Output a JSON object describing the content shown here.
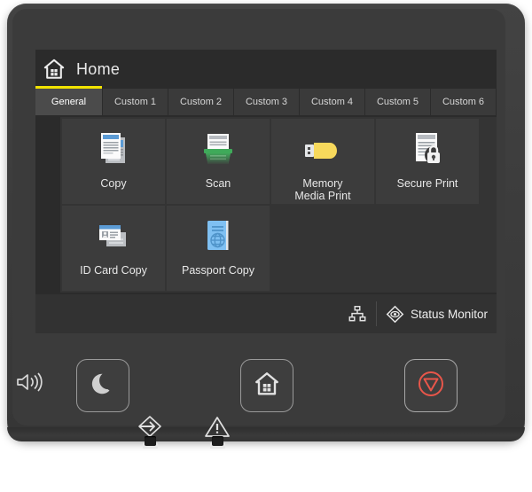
{
  "device": {
    "screen_header": {
      "home_icon": "home-house-icon",
      "title": "Home"
    },
    "tabs": [
      {
        "label": "General",
        "active": true
      },
      {
        "label": "Custom 1",
        "active": false
      },
      {
        "label": "Custom 2",
        "active": false
      },
      {
        "label": "Custom 3",
        "active": false
      },
      {
        "label": "Custom 4",
        "active": false
      },
      {
        "label": "Custom 5",
        "active": false
      },
      {
        "label": "Custom 6",
        "active": false
      }
    ],
    "functions": [
      {
        "label": "Copy",
        "icon": "copy-documents-icon"
      },
      {
        "label": "Scan",
        "icon": "scanner-icon"
      },
      {
        "label": "Memory\nMedia Print",
        "label_line1": "Memory",
        "label_line2": "Media Print",
        "icon": "usb-drive-icon"
      },
      {
        "label": "Secure Print",
        "icon": "document-lock-icon"
      },
      {
        "label": "ID Card Copy",
        "icon": "id-card-icon"
      },
      {
        "label": "Passport Copy",
        "icon": "passport-booklet-icon"
      }
    ],
    "status_bar": {
      "network_icon": "network-nodes-icon",
      "status_monitor_icon": "status-monitor-diamond-icon",
      "status_monitor_label": "Status Monitor"
    },
    "hardware_keys": [
      {
        "name": "energy-saver-key",
        "icon": "moon-icon"
      },
      {
        "name": "home-key",
        "icon": "home-house-icon"
      },
      {
        "name": "stop-key",
        "icon": "stop-circle-triangle-icon"
      }
    ],
    "indicators": [
      {
        "name": "speaker-indicator",
        "icon": "speaker-sound-icon"
      },
      {
        "name": "data-indicator",
        "icon": "data-arrow-diamond-icon"
      },
      {
        "name": "error-indicator",
        "icon": "warning-triangle-icon"
      }
    ],
    "colors": {
      "bezel": "#3d3d3d",
      "screen_bg": "#2b2b2b",
      "tile_bg": "#3c3c3c",
      "tab_active_bg": "#4b4b4b",
      "tab_accent": "#f2e300",
      "status_bar_bg": "#323232",
      "text": "#e9e9e9",
      "copy_blue": "#5b9bd5",
      "scan_green": "#3faa5a",
      "usb_yellow": "#f7d95c",
      "passport_blue": "#7fc0f2",
      "stop_red": "#e8564a"
    }
  }
}
